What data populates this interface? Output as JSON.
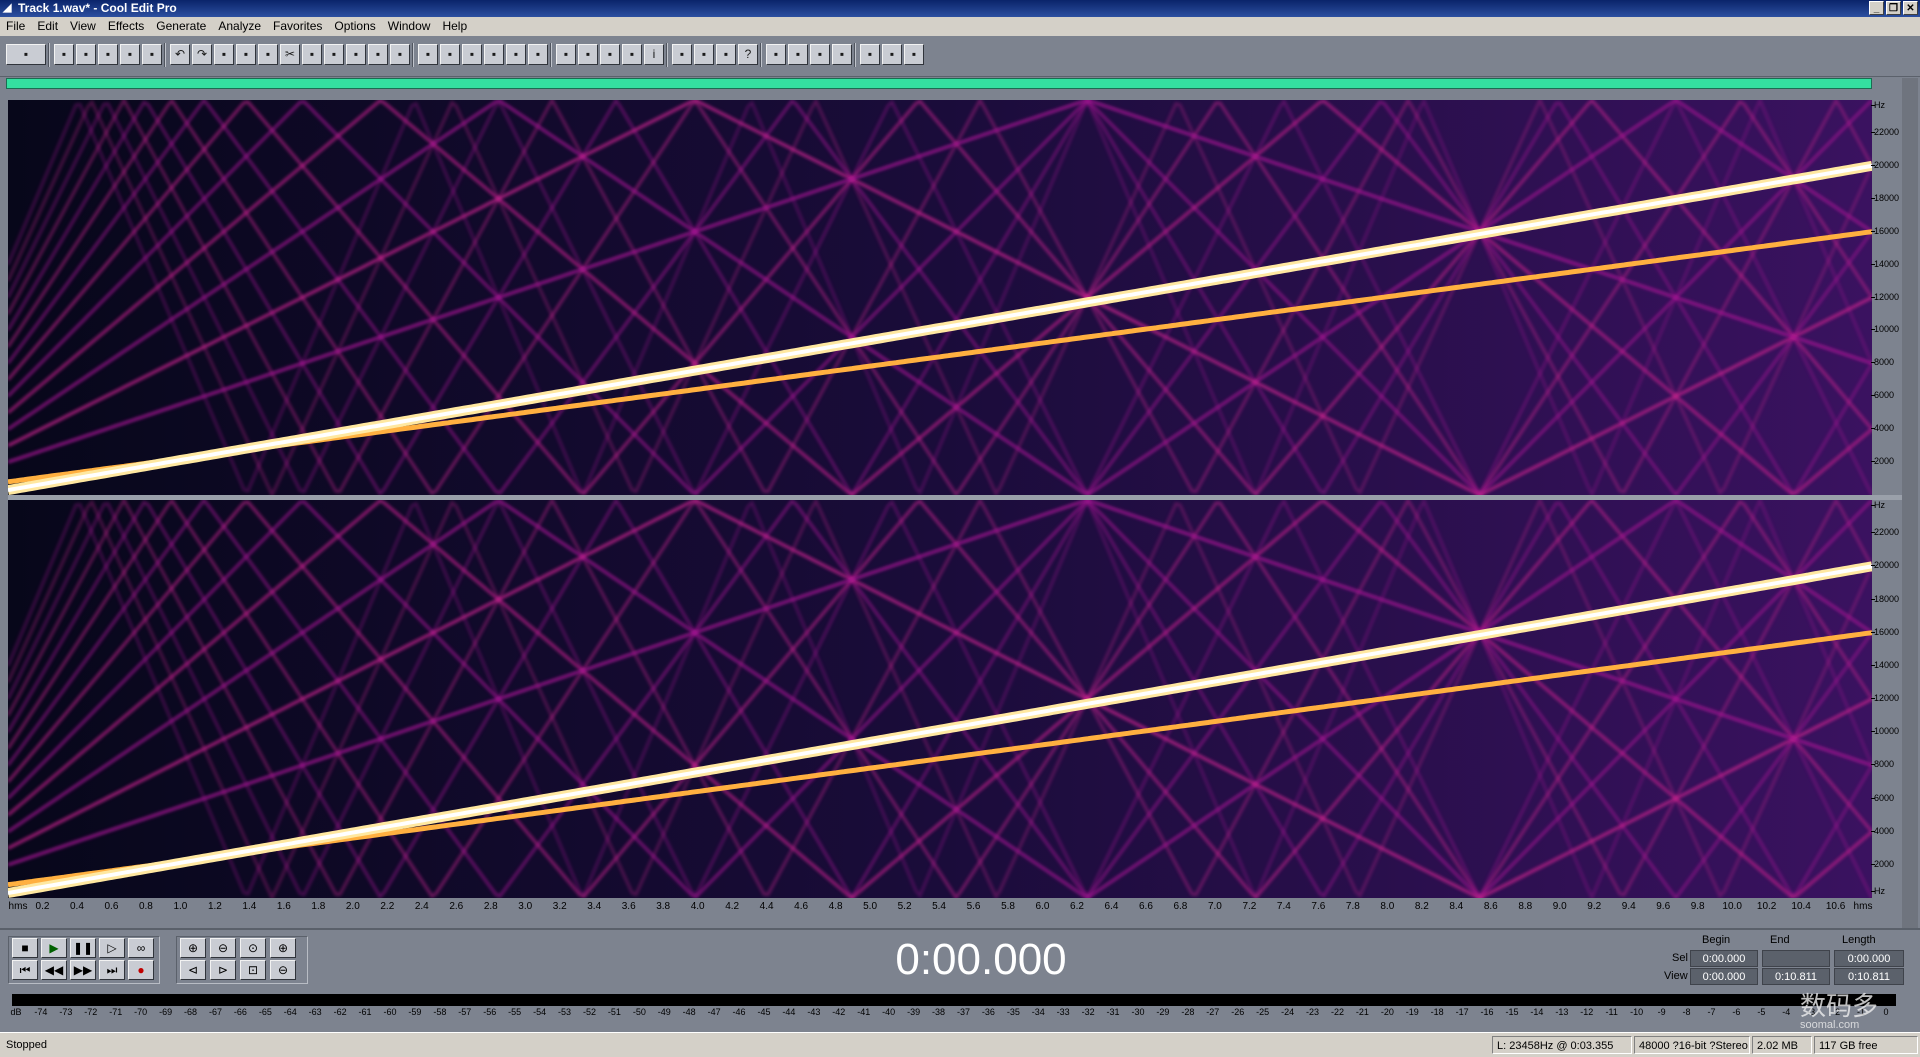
{
  "window": {
    "title": "Track 1.wav* - Cool Edit Pro",
    "controls": [
      "_",
      "❐",
      "✕"
    ]
  },
  "menu": [
    "File",
    "Edit",
    "View",
    "Effects",
    "Generate",
    "Analyze",
    "Favorites",
    "Options",
    "Window",
    "Help"
  ],
  "toolbar_icons": [
    "multitrack-view-icon",
    "new-icon",
    "open-icon",
    "save-icon",
    "save-all-icon",
    "close-file-icon",
    "undo-icon",
    "redo-icon",
    "repeat-icon",
    "select-all-icon",
    "copy-icon",
    "cut-icon",
    "paste-icon",
    "paste-new-icon",
    "mix-paste-icon",
    "crop-icon",
    "trim-icon",
    "waveform-view-icon",
    "spectral-view-icon",
    "hybrid-view-icon",
    "display-left-icon",
    "display-right-icon",
    "display-both-icon",
    "snap-icon",
    "time-display-icon",
    "cue-list-icon",
    "play-list-icon",
    "info-icon",
    "frequency-analysis-icon",
    "dx-effects-icon",
    "preferences-icon",
    "help-icon",
    "marker-icon",
    "regions-icon",
    "groups-icon",
    "batch-icon",
    "scripts-icon",
    "normalize-icon",
    "zoom-fit-icon"
  ],
  "spectral": {
    "y_unit": "Hz",
    "y_ticks": [
      "22000",
      "20000",
      "18000",
      "16000",
      "14000",
      "12000",
      "10000",
      "8000",
      "6000",
      "4000",
      "2000"
    ],
    "y_bottom": "Hz"
  },
  "time_ruler": {
    "start": "hms",
    "end": "hms",
    "ticks": [
      "0.2",
      "0.4",
      "0.6",
      "0.8",
      "1.0",
      "1.2",
      "1.4",
      "1.6",
      "1.8",
      "2.0",
      "2.2",
      "2.4",
      "2.6",
      "2.8",
      "3.0",
      "3.2",
      "3.4",
      "3.6",
      "3.8",
      "4.0",
      "4.2",
      "4.4",
      "4.6",
      "4.8",
      "5.0",
      "5.2",
      "5.4",
      "5.6",
      "5.8",
      "6.0",
      "6.2",
      "6.4",
      "6.6",
      "6.8",
      "7.0",
      "7.2",
      "7.4",
      "7.6",
      "7.8",
      "8.0",
      "8.2",
      "8.4",
      "8.6",
      "8.8",
      "9.0",
      "9.2",
      "9.4",
      "9.6",
      "9.8",
      "10.0",
      "10.2",
      "10.4",
      "10.6"
    ]
  },
  "transport": {
    "row1": [
      "stop-icon",
      "play-icon",
      "pause-icon",
      "play-to-end-icon",
      "loop-icon"
    ],
    "row2": [
      "go-start-icon",
      "rewind-icon",
      "fast-forward-icon",
      "go-end-icon",
      "record-icon"
    ],
    "zoom_row1": [
      "zoom-in-h-icon",
      "zoom-out-h-icon",
      "zoom-full-icon",
      "zoom-in-v-icon"
    ],
    "zoom_row2": [
      "zoom-left-icon",
      "zoom-right-icon",
      "zoom-sel-icon",
      "zoom-out-v-icon"
    ]
  },
  "time_display": "0:00.000",
  "selection": {
    "headers": {
      "begin": "Begin",
      "end": "End",
      "length": "Length"
    },
    "sel_label": "Sel",
    "view_label": "View",
    "sel": {
      "begin": "0:00.000",
      "end": "",
      "length": "0:00.000"
    },
    "view": {
      "begin": "0:00.000",
      "end": "0:10.811",
      "length": "0:10.811"
    }
  },
  "meter": {
    "labels": [
      "dB",
      "-74",
      "-73",
      "-72",
      "-71",
      "-70",
      "-69",
      "-68",
      "-67",
      "-66",
      "-65",
      "-64",
      "-63",
      "-62",
      "-61",
      "-60",
      "-59",
      "-58",
      "-57",
      "-56",
      "-55",
      "-54",
      "-53",
      "-52",
      "-51",
      "-50",
      "-49",
      "-48",
      "-47",
      "-46",
      "-45",
      "-44",
      "-43",
      "-42",
      "-41",
      "-40",
      "-39",
      "-38",
      "-37",
      "-36",
      "-35",
      "-34",
      "-33",
      "-32",
      "-31",
      "-30",
      "-29",
      "-28",
      "-27",
      "-26",
      "-25",
      "-24",
      "-23",
      "-22",
      "-21",
      "-20",
      "-19",
      "-18",
      "-17",
      "-16",
      "-15",
      "-14",
      "-13",
      "-12",
      "-11",
      "-10",
      "-9",
      "-8",
      "-7",
      "-6",
      "-5",
      "-4",
      "-3",
      "-2",
      "-1",
      "0"
    ]
  },
  "status": {
    "state": "Stopped",
    "cursor": "L: 23458Hz @   0:03.355",
    "format": "48000 ?16-bit ?Stereo",
    "size": "2.02 MB",
    "free": "117 GB free"
  },
  "watermark": {
    "main": "数码多",
    "sub": "soomal.com"
  },
  "colors": {
    "spectrum_bg": "#0a0a22",
    "overview": "#34e0a0",
    "panel": "#7d838f"
  }
}
